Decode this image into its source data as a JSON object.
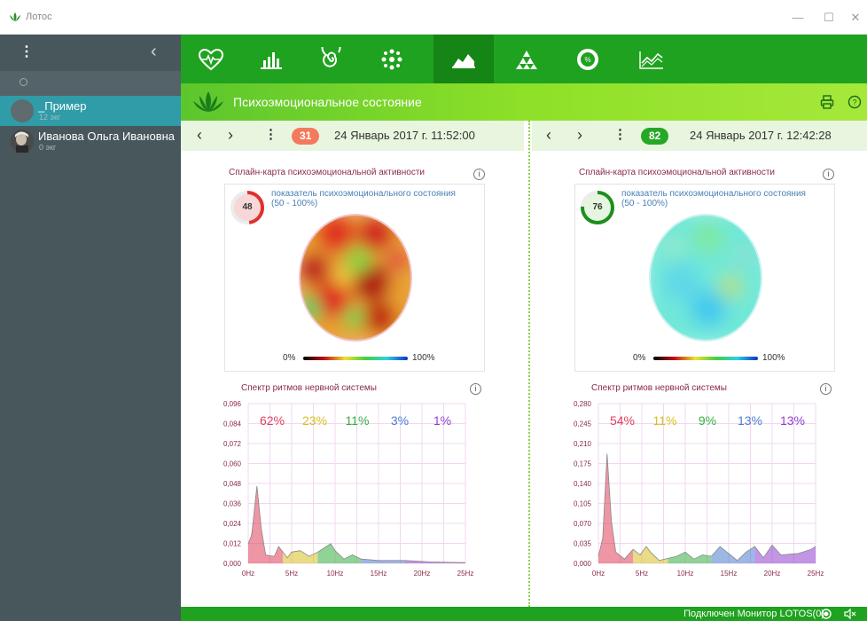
{
  "window": {
    "title": "Лотос",
    "min": "—",
    "max": "☐",
    "close": "✕"
  },
  "sidebar": {
    "patients": [
      {
        "name": "_Пример",
        "sub": "12 экг"
      },
      {
        "name": "Иванова Ольга Ивановна",
        "sub": "0 экг"
      }
    ]
  },
  "toolbar": {
    "icons": [
      "heart-pulse-icon",
      "bar-chart-icon",
      "spiral-icon",
      "dots-cluster-icon",
      "area-chart-icon",
      "triangles-icon",
      "percent-circle-icon",
      "line-chart-icon"
    ],
    "active": 4
  },
  "header": {
    "title": "Психоэмоциональное состояние"
  },
  "panels": [
    {
      "badge": "31",
      "badge_color": "#f47a5e",
      "date": "24 Январь 2017 г. 11:52:00",
      "map_title": "Сплайн-карта психоэмоциональной активности",
      "indicator_value": "48",
      "indicator_label": "показатель психоэмоционального состояния",
      "indicator_range": "(50 - 100%)",
      "ring_color": "#e03030",
      "scale_min": "0%",
      "scale_max": "100%",
      "spectrum_title": "Спектр ритмов нервной системы",
      "yticks": [
        "0,096",
        "0,084",
        "0,072",
        "0,060",
        "0,048",
        "0,036",
        "0,024",
        "0,012",
        "0,000"
      ],
      "xticks": [
        "0Hz",
        "5Hz",
        "10Hz",
        "15Hz",
        "20Hz",
        "25Hz"
      ],
      "percents": [
        "62%",
        "23%",
        "11%",
        "3%",
        "1%"
      ]
    },
    {
      "badge": "82",
      "badge_color": "#26a826",
      "date": "24 Январь 2017 г. 12:42:28",
      "map_title": "Сплайн-карта психоэмоциональной активности",
      "indicator_value": "76",
      "indicator_label": "показатель психоэмоционального состояния",
      "indicator_range": "(50 - 100%)",
      "ring_color": "#1c8f1c",
      "scale_min": "0%",
      "scale_max": "100%",
      "spectrum_title": "Спектр ритмов нервной системы",
      "yticks": [
        "0,280",
        "0,245",
        "0,210",
        "0,175",
        "0,140",
        "0,105",
        "0,070",
        "0,035",
        "0,000"
      ],
      "xticks": [
        "0Hz",
        "5Hz",
        "10Hz",
        "15Hz",
        "20Hz",
        "25Hz"
      ],
      "percents": [
        "54%",
        "11%",
        "9%",
        "13%",
        "13%"
      ]
    }
  ],
  "band_colors": [
    "#e0405a",
    "#d8c020",
    "#33b040",
    "#4c7dd0",
    "#9040d0"
  ],
  "status": {
    "text": "Подключен Монитор LOTOS(0)"
  }
}
